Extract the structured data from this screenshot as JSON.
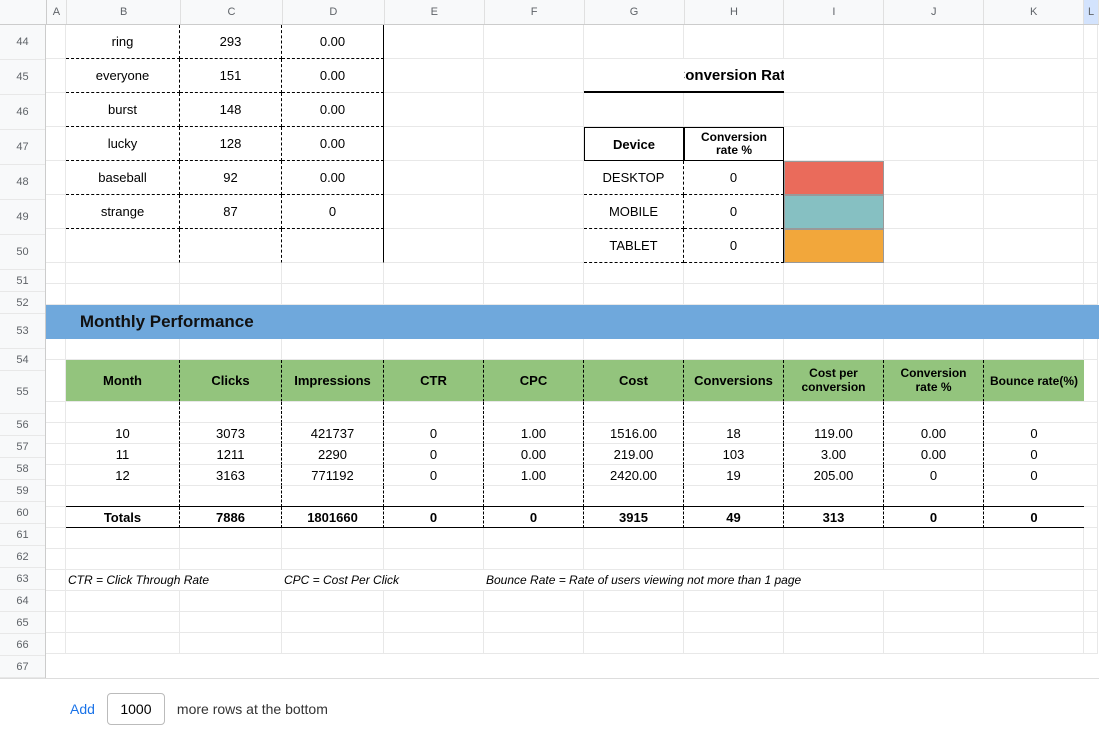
{
  "columns": [
    "A",
    "B",
    "C",
    "D",
    "E",
    "F",
    "G",
    "H",
    "I",
    "J",
    "K",
    "L"
  ],
  "row_start": 44,
  "row_end": 67,
  "top_table": {
    "rows": [
      {
        "b": "ring",
        "c": "293",
        "d": "0.00"
      },
      {
        "b": "everyone",
        "c": "151",
        "d": "0.00"
      },
      {
        "b": "burst",
        "c": "148",
        "d": "0.00"
      },
      {
        "b": "lucky",
        "c": "128",
        "d": "0.00"
      },
      {
        "b": "baseball",
        "c": "92",
        "d": "0.00"
      },
      {
        "b": "strange",
        "c": "87",
        "d": "0"
      }
    ]
  },
  "conversion_rate": {
    "title": "Conversion Rate",
    "headers": {
      "device": "Device",
      "rate": "Conversion rate %"
    },
    "rows": [
      {
        "device": "DESKTOP",
        "rate": "0",
        "swatch": "red"
      },
      {
        "device": "MOBILE",
        "rate": "0",
        "swatch": "teal"
      },
      {
        "device": "TABLET",
        "rate": "0",
        "swatch": "orange"
      }
    ]
  },
  "section_title": "Monthly Performance",
  "monthly": {
    "headers": [
      "Month",
      "Clicks",
      "Impressions",
      "CTR",
      "CPC",
      "Cost",
      "Conversions",
      "Cost per conversion",
      "Conversion rate %",
      "Bounce rate(%)"
    ],
    "rows": [
      [
        "10",
        "3073",
        "421737",
        "0",
        "1.00",
        "1516.00",
        "18",
        "119.00",
        "0.00",
        "0"
      ],
      [
        "11",
        "1211",
        "2290",
        "0",
        "0.00",
        "219.00",
        "103",
        "3.00",
        "0.00",
        "0"
      ],
      [
        "12",
        "3163",
        "771192",
        "0",
        "1.00",
        "2420.00",
        "19",
        "205.00",
        "0",
        "0"
      ]
    ],
    "totals_label": "Totals",
    "totals": [
      "7886",
      "1801660",
      "0",
      "0",
      "3915",
      "49",
      "313",
      "0",
      "0"
    ]
  },
  "legend": {
    "ctr": "CTR = Click Through Rate",
    "cpc": "CPC  = Cost Per Click",
    "bounce": "Bounce Rate  = Rate of users viewing not more than 1 page"
  },
  "footer": {
    "add": "Add",
    "rows_value": "1000",
    "suffix": "more rows at the bottom"
  },
  "selected_column": "L"
}
